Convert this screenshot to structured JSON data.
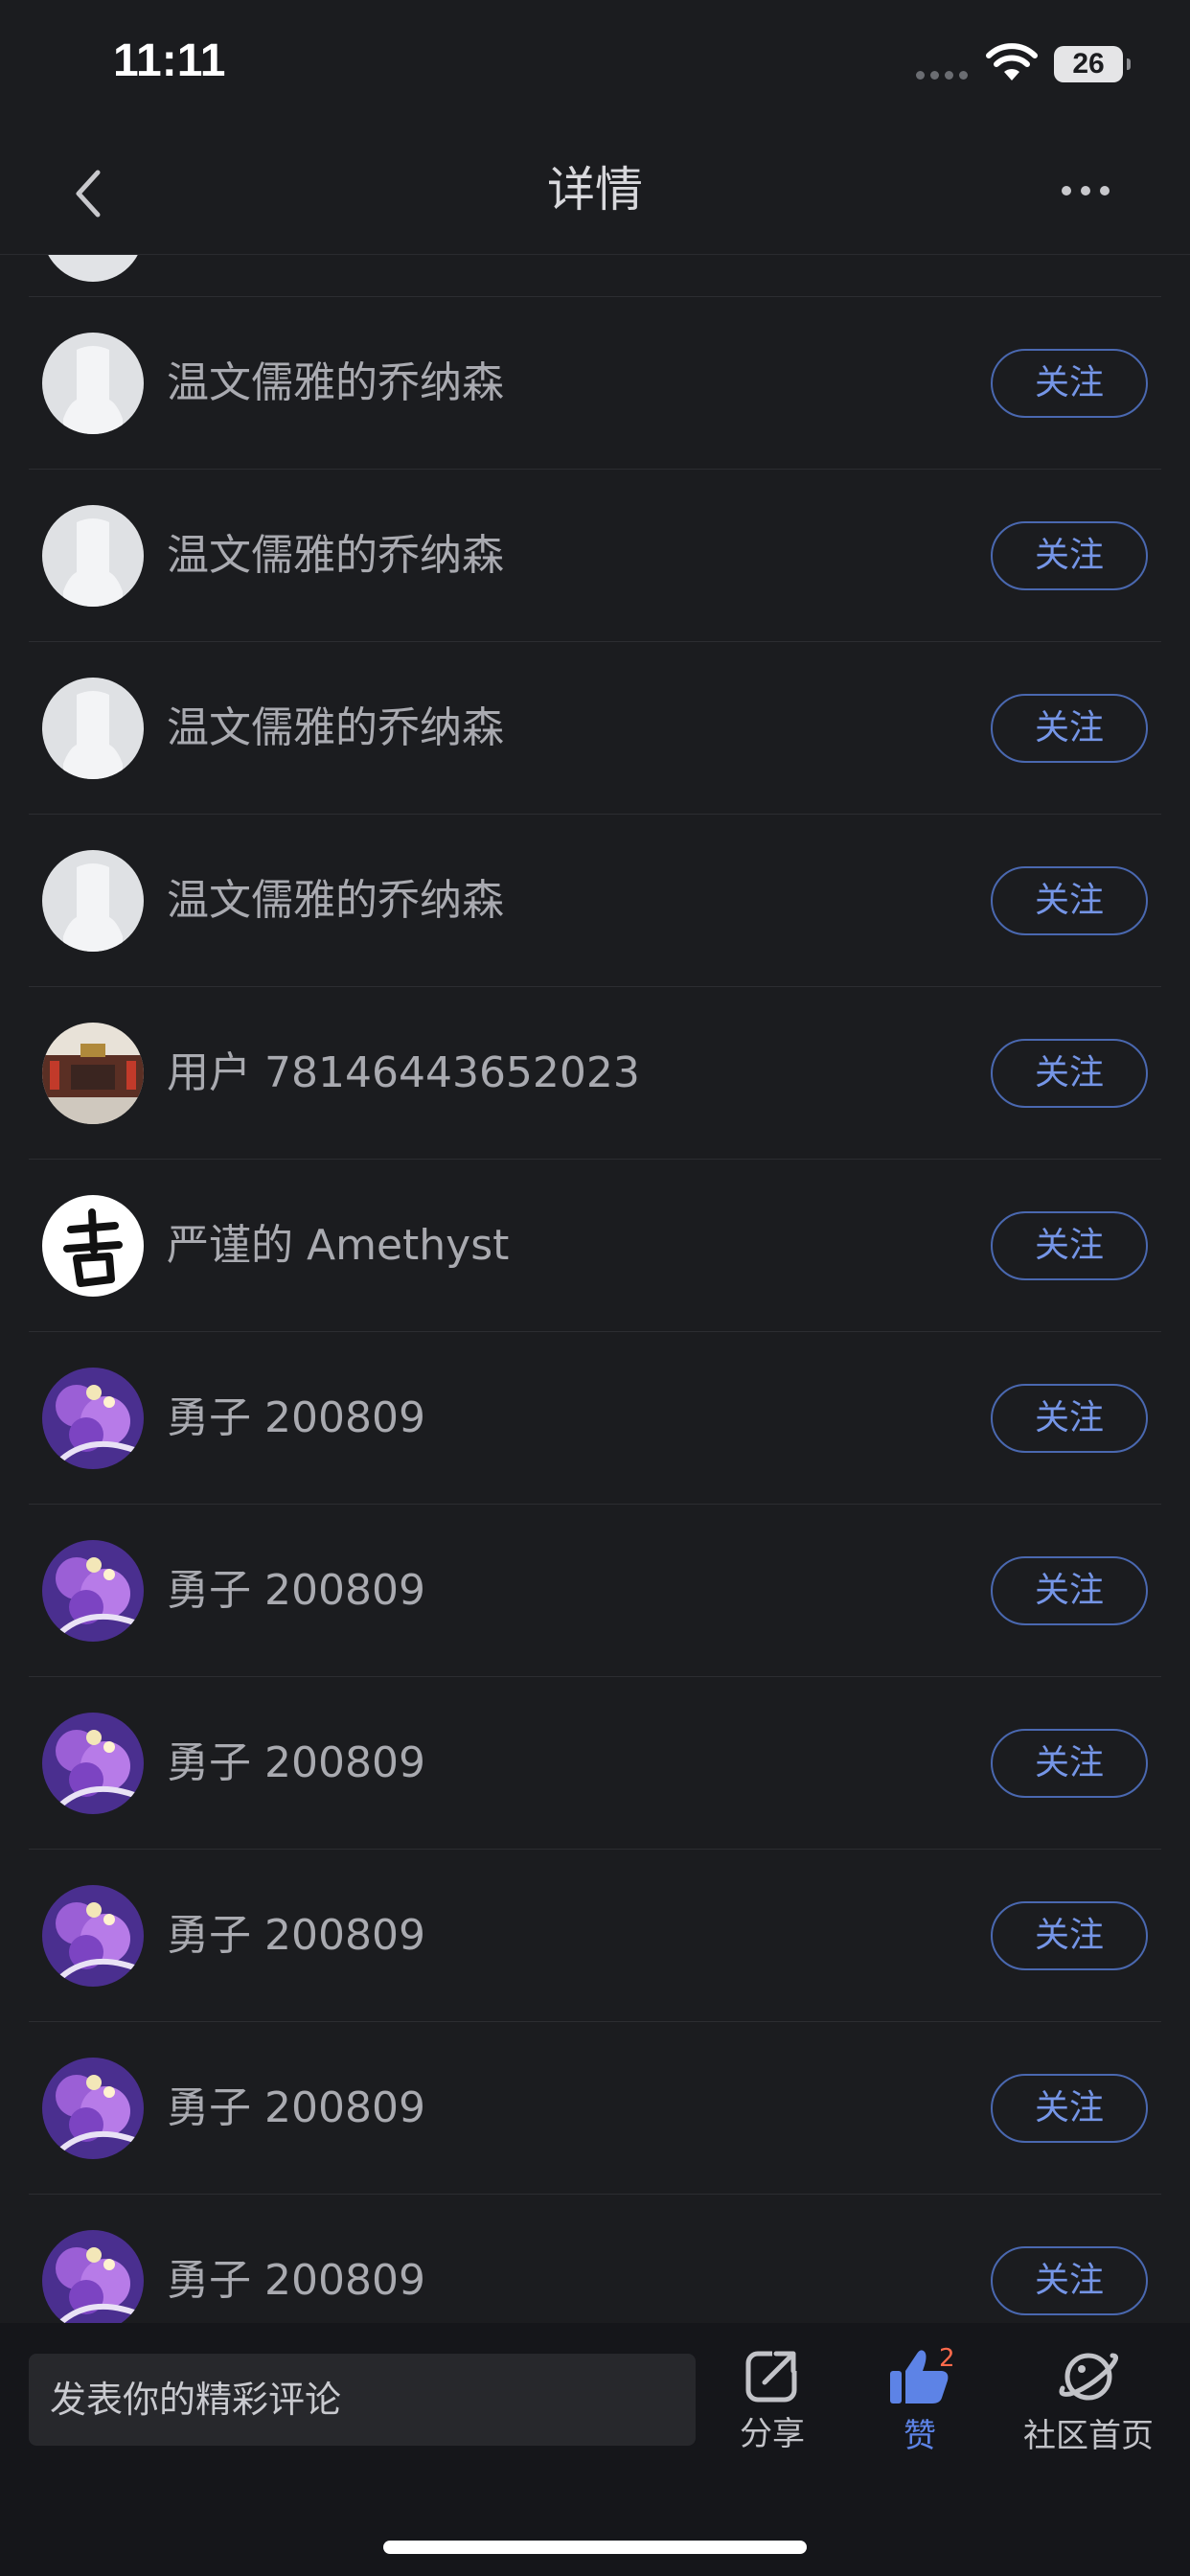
{
  "status_bar": {
    "time": "11:11",
    "battery": "26"
  },
  "nav": {
    "title": "详情"
  },
  "follow_label": "关注",
  "users": [
    {
      "name": "温文儒雅的乔纳森",
      "avatar": "default-avatar-icon"
    },
    {
      "name": "温文儒雅的乔纳森",
      "avatar": "default-avatar-icon"
    },
    {
      "name": "温文儒雅的乔纳森",
      "avatar": "default-avatar-icon"
    },
    {
      "name": "温文儒雅的乔纳森",
      "avatar": "default-avatar-icon"
    },
    {
      "name": "用户 78146443652023",
      "avatar": "temple-photo-avatar"
    },
    {
      "name": "严谨的 Amethyst",
      "avatar": "calligraphy-avatar"
    },
    {
      "name": "勇子 200809",
      "avatar": "purple-blossom-avatar"
    },
    {
      "name": "勇子 200809",
      "avatar": "purple-blossom-avatar"
    },
    {
      "name": "勇子 200809",
      "avatar": "purple-blossom-avatar"
    },
    {
      "name": "勇子 200809",
      "avatar": "purple-blossom-avatar"
    },
    {
      "name": "勇子 200809",
      "avatar": "purple-blossom-avatar"
    },
    {
      "name": "勇子 200809",
      "avatar": "purple-blossom-avatar"
    }
  ],
  "bottom_bar": {
    "comment_placeholder": "发表你的精彩评论",
    "share_label": "分享",
    "like_label": "赞",
    "like_count": "2",
    "community_label": "社区首页"
  },
  "colors": {
    "background": "#1b1c1f",
    "accent": "#5d83e6",
    "badge": "#ff6a4b"
  }
}
